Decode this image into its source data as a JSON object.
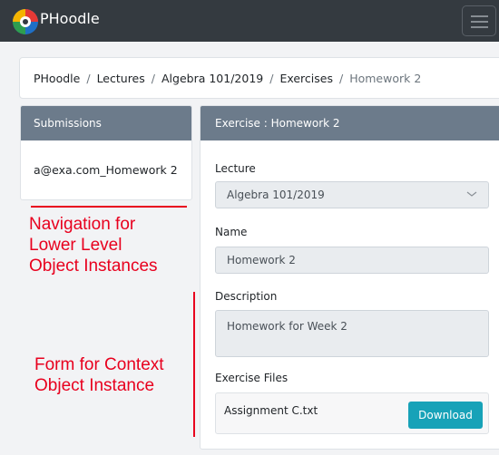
{
  "navbar": {
    "brand": "PHoodle",
    "logo_icon": "phoodle-logo-icon",
    "toggler_icon": "hamburger-icon",
    "background": "#343a40"
  },
  "breadcrumb": {
    "items": [
      "PHoodle",
      "Lectures",
      "Algebra 101/2019",
      "Exercises",
      "Homework 2"
    ],
    "separator": "/"
  },
  "submissions_panel": {
    "title": "Submissions",
    "items": [
      "a@exa.com_Homework 2"
    ]
  },
  "exercise_panel": {
    "title": "Exercise : Homework 2",
    "lecture": {
      "label": "Lecture",
      "value": "Algebra 101/2019",
      "icon": "chevron-down-icon"
    },
    "name": {
      "label": "Name",
      "value": "Homework 2"
    },
    "description": {
      "label": "Description",
      "value": "Homework for Week 2"
    },
    "files": {
      "label": "Exercise Files",
      "file_name": "Assignment C.txt",
      "download_label": "Download"
    }
  },
  "annotations": {
    "navigation": [
      "Navigation for",
      "Lower Level",
      "Object Instances"
    ],
    "form": [
      "Form for Context",
      "Object Instance"
    ],
    "color": "#e8001e"
  },
  "colors": {
    "panel_header": "#6c7b8b",
    "button": "#17a2b8",
    "page_background": "#f2f3f5"
  }
}
